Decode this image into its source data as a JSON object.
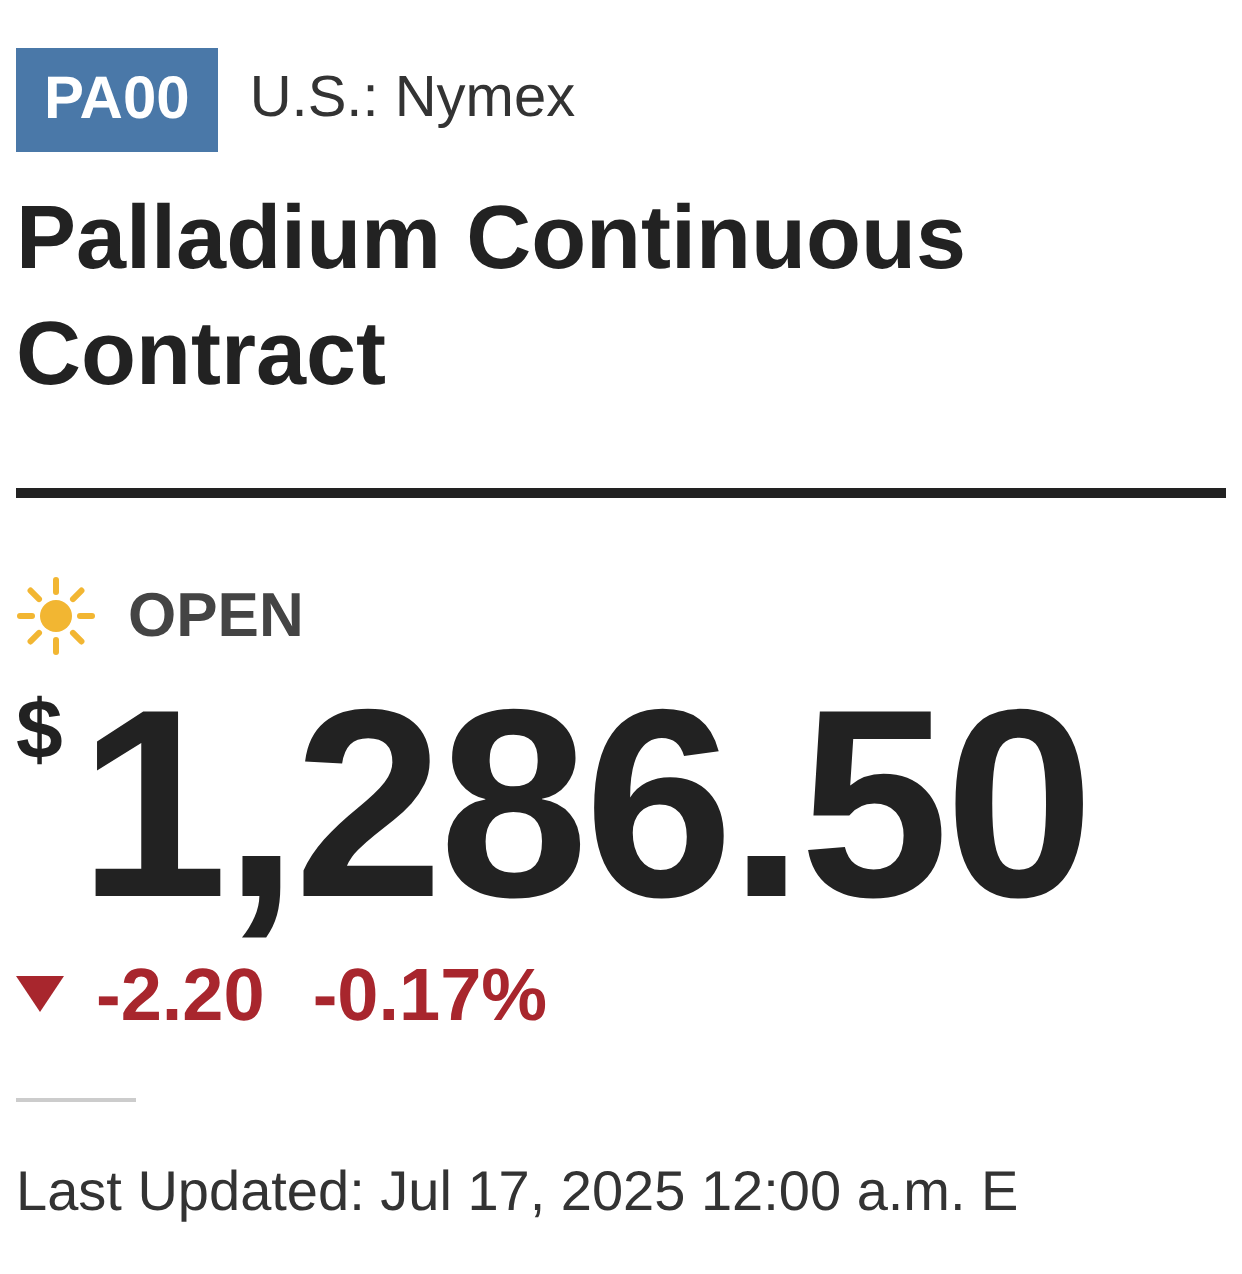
{
  "ticker": {
    "symbol": "PA00",
    "exchange": "U.S.: Nymex"
  },
  "title": "Palladium Continuous Contract",
  "market_status": {
    "label": "OPEN",
    "open": true
  },
  "price": {
    "currency": "$",
    "value": "1,286.50"
  },
  "change": {
    "down": true,
    "amount": "-2.20",
    "percent": "-0.17%"
  },
  "last_updated": "Last Updated: Jul 17, 2025 12:00 a.m. E"
}
